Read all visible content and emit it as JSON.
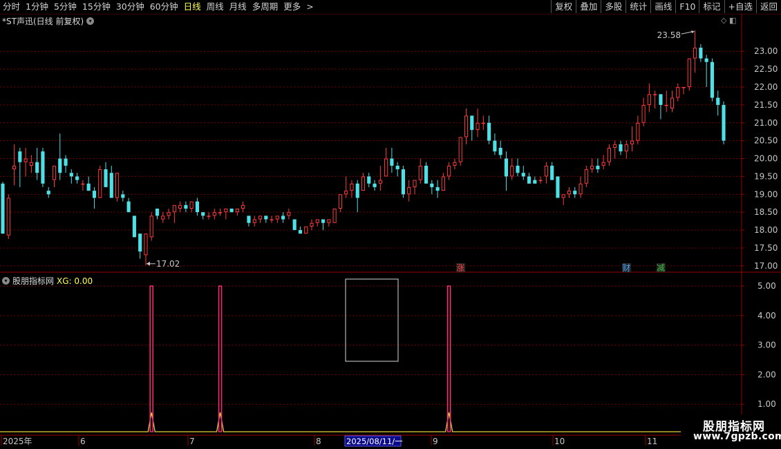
{
  "toolbar": {
    "periods": [
      "分时",
      "1分钟",
      "5分钟",
      "15分钟",
      "30分钟",
      "60分钟",
      "日线",
      "周线",
      "月线",
      "多周期",
      "更多"
    ],
    "more_arrow": ">",
    "active": "日线",
    "buttons": [
      "复权",
      "叠加",
      "多股",
      "统计",
      "画线",
      "F10",
      "标记",
      "+自选",
      "返回"
    ]
  },
  "chart": {
    "title": "*ST声迅(日线 前复权)",
    "dropdown_icon": "chevron-down-icon",
    "price_ticks": [
      "23.00",
      "22.50",
      "22.00",
      "21.50",
      "21.00",
      "20.50",
      "20.00",
      "19.50",
      "19.00",
      "18.50",
      "18.00",
      "17.50",
      "17.00"
    ],
    "high_label": "23.58",
    "low_label": "17.02",
    "markers": [
      {
        "label": "涨",
        "color": "#ff4040"
      },
      {
        "label": "财",
        "color": "#4da6ff"
      },
      {
        "label": "减",
        "color": "#40c040"
      }
    ]
  },
  "indicator": {
    "name": "股朋指标网",
    "xg_label": "XG: 0.00",
    "ticks": [
      "5.00",
      "4.00",
      "3.00",
      "2.00",
      "1.00"
    ]
  },
  "date_axis": {
    "labels": [
      "2025年",
      "6",
      "7",
      "8",
      "9",
      "10",
      "11"
    ],
    "cursor_date": "2025/08/11/一"
  },
  "watermark": {
    "line1": "股朋指标网",
    "line2": "www.7gpzb.com"
  },
  "colors": {
    "up": "#ff3b3b",
    "down": "#4de0e6",
    "signal": "#ff2a7a",
    "signal_line": "#e6d23a",
    "grid": "#7a0000",
    "axis": "#9a0000",
    "active_tab": "#ffff4d"
  },
  "chart_data": [
    {
      "type": "candlestick",
      "title": "*ST声迅(日线 前复权)",
      "ylim": [
        16.9,
        23.7
      ],
      "x_axis": [
        "2025年",
        "6",
        "7",
        "8",
        "9",
        "10",
        "11"
      ],
      "series": [
        {
          "name": "K线",
          "ohlc": [
            [
              19.3,
              19.35,
              17.9,
              17.9
            ],
            [
              17.85,
              19.0,
              17.75,
              18.9
            ],
            [
              19.7,
              20.4,
              19.25,
              19.8
            ],
            [
              20.2,
              20.3,
              19.2,
              19.9
            ],
            [
              19.9,
              20.3,
              19.5,
              20.0
            ],
            [
              19.8,
              20.1,
              19.6,
              19.9
            ],
            [
              19.9,
              20.3,
              19.4,
              19.6
            ],
            [
              20.2,
              20.3,
              19.2,
              19.3
            ],
            [
              19.1,
              19.2,
              18.9,
              19.0
            ],
            [
              19.4,
              19.8,
              19.2,
              19.8
            ],
            [
              20.0,
              20.7,
              19.4,
              19.6
            ],
            [
              20.0,
              20.1,
              19.6,
              19.8
            ],
            [
              19.6,
              19.7,
              19.3,
              19.5
            ],
            [
              19.5,
              19.6,
              19.3,
              19.4
            ],
            [
              19.3,
              19.4,
              19.1,
              19.3
            ],
            [
              19.3,
              19.5,
              19.1,
              19.1
            ],
            [
              19.1,
              19.2,
              18.6,
              18.9
            ],
            [
              18.9,
              19.8,
              18.9,
              19.7
            ],
            [
              19.7,
              19.9,
              19.3,
              19.2
            ],
            [
              19.6,
              19.8,
              19.2,
              18.9
            ],
            [
              18.9,
              19.6,
              18.8,
              19.6
            ],
            [
              19.0,
              19.1,
              18.8,
              18.9
            ],
            [
              18.8,
              18.9,
              18.5,
              18.5
            ],
            [
              18.4,
              18.4,
              17.8,
              17.8
            ],
            [
              17.9,
              17.9,
              17.2,
              17.4
            ],
            [
              17.3,
              17.9,
              17.02,
              17.9
            ],
            [
              17.8,
              18.5,
              17.7,
              18.4
            ],
            [
              18.6,
              18.6,
              18.3,
              18.4
            ],
            [
              18.3,
              18.5,
              18.2,
              18.4
            ],
            [
              18.4,
              18.6,
              18.3,
              18.5
            ],
            [
              18.5,
              18.7,
              18.2,
              18.7
            ],
            [
              18.6,
              18.8,
              18.5,
              18.7
            ],
            [
              18.7,
              18.8,
              18.5,
              18.6
            ],
            [
              18.6,
              18.8,
              18.5,
              18.8
            ],
            [
              18.8,
              18.9,
              18.4,
              18.5
            ],
            [
              18.5,
              18.5,
              18.3,
              18.4
            ],
            [
              18.4,
              18.5,
              18.3,
              18.4
            ],
            [
              18.4,
              18.6,
              18.3,
              18.5
            ],
            [
              18.5,
              18.6,
              18.4,
              18.5
            ],
            [
              18.5,
              18.6,
              18.3,
              18.6
            ],
            [
              18.6,
              18.6,
              18.5,
              18.5
            ],
            [
              18.5,
              18.6,
              18.4,
              18.6
            ],
            [
              18.6,
              18.8,
              18.5,
              18.7
            ],
            [
              18.4,
              18.4,
              18.1,
              18.2
            ],
            [
              18.2,
              18.4,
              18.1,
              18.3
            ],
            [
              18.3,
              18.4,
              18.2,
              18.4
            ],
            [
              18.4,
              18.4,
              18.2,
              18.3
            ],
            [
              18.3,
              18.4,
              18.2,
              18.3
            ],
            [
              18.3,
              18.4,
              18.2,
              18.4
            ],
            [
              18.4,
              18.5,
              18.2,
              18.3
            ],
            [
              18.4,
              18.6,
              18.3,
              18.5
            ],
            [
              18.3,
              18.3,
              18.0,
              18.0
            ],
            [
              18.0,
              18.1,
              17.9,
              17.9
            ],
            [
              17.9,
              18.1,
              17.9,
              18.1
            ],
            [
              18.1,
              18.3,
              18.0,
              18.2
            ],
            [
              18.2,
              18.3,
              18.1,
              18.3
            ],
            [
              18.3,
              18.3,
              18.0,
              18.2
            ],
            [
              18.2,
              18.3,
              18.1,
              18.3
            ],
            [
              18.2,
              18.6,
              18.2,
              18.6
            ],
            [
              18.6,
              19.0,
              18.5,
              19.0
            ],
            [
              19.0,
              19.5,
              18.9,
              19.1
            ],
            [
              19.1,
              19.4,
              18.9,
              19.3
            ],
            [
              19.3,
              19.4,
              18.5,
              18.9
            ],
            [
              19.1,
              19.6,
              19.1,
              19.5
            ],
            [
              19.5,
              19.6,
              19.2,
              19.3
            ],
            [
              19.3,
              19.4,
              19.1,
              19.2
            ],
            [
              19.3,
              19.8,
              19.1,
              19.4
            ],
            [
              19.5,
              20.3,
              19.5,
              20.0
            ],
            [
              20.0,
              20.3,
              19.6,
              19.8
            ],
            [
              19.8,
              19.9,
              19.5,
              19.7
            ],
            [
              19.7,
              19.8,
              18.9,
              19.0
            ],
            [
              19.0,
              19.4,
              18.8,
              19.2
            ],
            [
              19.2,
              19.4,
              19.0,
              19.4
            ],
            [
              19.4,
              20.0,
              19.3,
              19.8
            ],
            [
              19.8,
              19.9,
              19.3,
              19.3
            ],
            [
              19.3,
              19.4,
              19.0,
              19.2
            ],
            [
              19.2,
              19.4,
              18.9,
              19.1
            ],
            [
              19.1,
              19.6,
              19.1,
              19.5
            ],
            [
              19.5,
              19.9,
              19.4,
              19.8
            ],
            [
              19.8,
              20.0,
              19.7,
              19.9
            ],
            [
              19.9,
              20.6,
              19.8,
              20.6
            ],
            [
              20.6,
              21.4,
              20.4,
              21.2
            ],
            [
              21.2,
              21.2,
              20.5,
              20.8
            ],
            [
              20.8,
              21.4,
              20.6,
              21.0
            ],
            [
              21.0,
              21.2,
              20.8,
              21.0
            ],
            [
              21.0,
              21.2,
              20.4,
              20.5
            ],
            [
              20.5,
              20.7,
              20.1,
              20.2
            ],
            [
              20.3,
              20.5,
              20.0,
              20.1
            ],
            [
              20.0,
              20.2,
              19.1,
              19.5
            ],
            [
              19.5,
              20.0,
              19.4,
              19.8
            ],
            [
              19.8,
              20.0,
              19.5,
              19.6
            ],
            [
              19.6,
              19.8,
              19.4,
              19.5
            ],
            [
              19.5,
              19.6,
              19.3,
              19.3
            ],
            [
              19.4,
              19.5,
              19.3,
              19.3
            ],
            [
              19.4,
              19.5,
              19.3,
              19.4
            ],
            [
              19.5,
              19.9,
              19.3,
              19.8
            ],
            [
              19.8,
              19.9,
              19.4,
              19.4
            ],
            [
              19.5,
              19.5,
              18.9,
              18.9
            ],
            [
              18.9,
              19.0,
              18.7,
              19.0
            ],
            [
              19.0,
              19.2,
              18.9,
              19.1
            ],
            [
              19.1,
              19.2,
              18.9,
              19.0
            ],
            [
              19.0,
              19.5,
              18.9,
              19.3
            ],
            [
              19.3,
              19.8,
              19.2,
              19.7
            ],
            [
              19.7,
              20.0,
              19.6,
              19.8
            ],
            [
              19.8,
              20.0,
              19.6,
              19.7
            ],
            [
              19.8,
              20.1,
              19.7,
              19.9
            ],
            [
              19.9,
              20.4,
              19.8,
              20.3
            ],
            [
              20.3,
              20.5,
              20.0,
              20.4
            ],
            [
              20.4,
              20.5,
              20.1,
              20.2
            ],
            [
              20.2,
              20.5,
              20.0,
              20.4
            ],
            [
              20.4,
              20.9,
              20.2,
              20.5
            ],
            [
              20.5,
              21.2,
              20.4,
              21.0
            ],
            [
              21.0,
              21.7,
              20.9,
              21.5
            ],
            [
              21.5,
              22.1,
              21.3,
              21.8
            ],
            [
              21.8,
              21.9,
              21.4,
              21.8
            ],
            [
              21.8,
              21.8,
              21.1,
              21.5
            ],
            [
              21.5,
              21.9,
              21.3,
              21.5
            ],
            [
              21.4,
              21.9,
              21.3,
              21.7
            ],
            [
              21.7,
              22.1,
              21.6,
              22.0
            ],
            [
              22.0,
              22.0,
              21.8,
              22.0
            ],
            [
              22.0,
              22.8,
              21.9,
              22.8
            ],
            [
              22.8,
              23.58,
              22.4,
              23.1
            ],
            [
              23.1,
              23.2,
              22.7,
              22.8
            ],
            [
              22.8,
              22.9,
              22.0,
              22.7
            ],
            [
              22.7,
              22.8,
              21.6,
              21.7
            ],
            [
              21.7,
              21.9,
              21.2,
              21.5
            ],
            [
              21.5,
              21.6,
              20.4,
              20.5
            ]
          ]
        }
      ]
    },
    {
      "type": "line",
      "title": "股朋指标网",
      "ylim": [
        0,
        5.4
      ],
      "series": [
        {
          "name": "XG",
          "signals_at_bar": [
            26,
            38,
            78
          ],
          "signal_value": 5.0,
          "last_value": 0.0
        }
      ]
    }
  ]
}
